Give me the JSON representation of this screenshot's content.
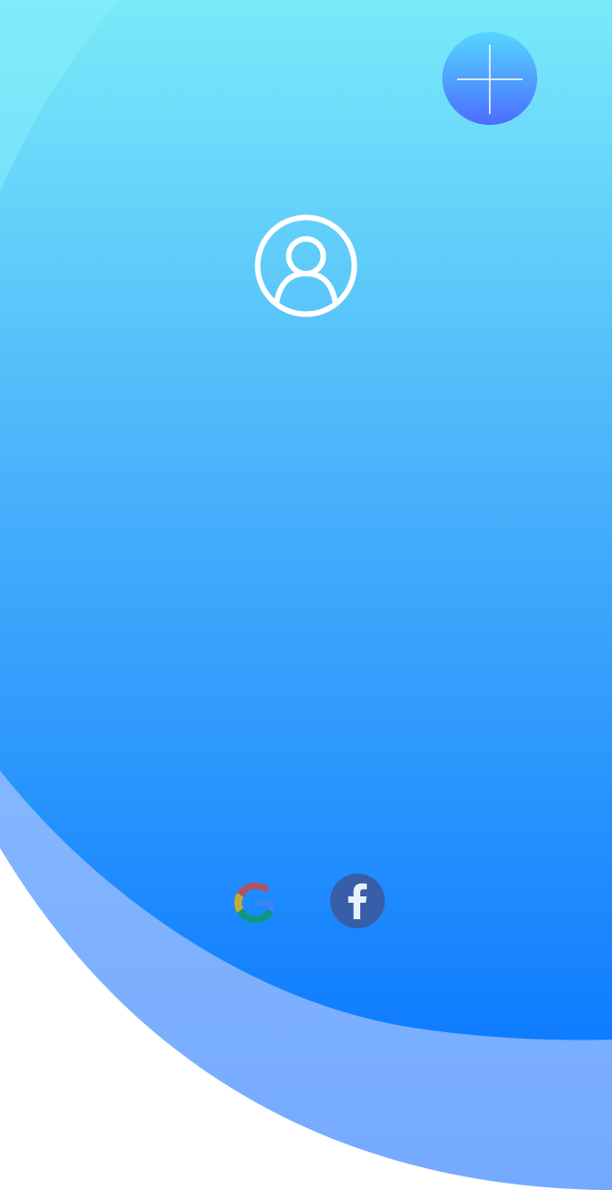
{
  "screen": {
    "colors": {
      "top_gradient": "#7aeaf9",
      "bottom_gradient": "#0f7cff",
      "back_arc": "#7aa7ff",
      "background": "#ffffff"
    }
  },
  "header": {
    "add_button_icon": "plus-icon"
  },
  "profile": {
    "avatar_icon": "user-circle-icon"
  },
  "social_login": {
    "google_icon": "google-icon",
    "facebook_icon": "facebook-icon",
    "colors": {
      "facebook": "#3b5a9e"
    }
  }
}
